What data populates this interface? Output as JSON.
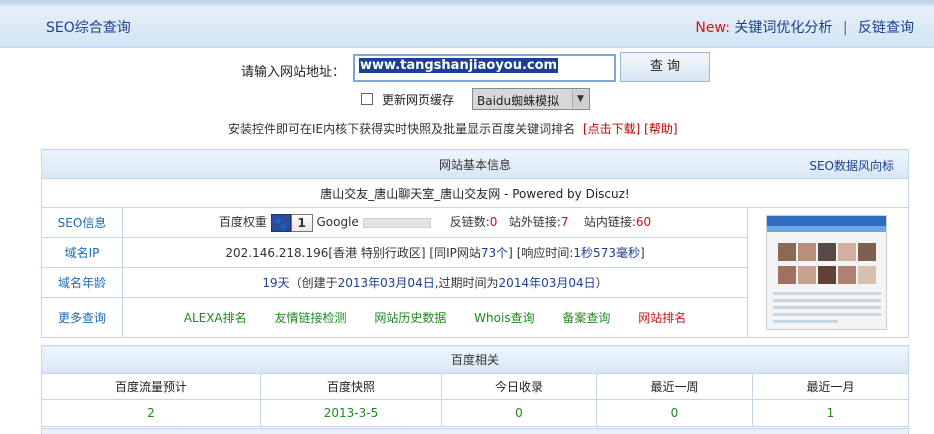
{
  "header": {
    "title": "SEO综合查询",
    "new_label": "New:",
    "link1": "关键词优化分析",
    "separator": "|",
    "link2": "反链查询"
  },
  "query": {
    "label": "请输入网站地址：",
    "url_value": "www.tangshanjiaoyou.com",
    "button": "查 询",
    "cache_label": "更新网页缓存",
    "spider_select": "Baidu蜘蛛模拟",
    "notice_text": "安装控件即可在IE内核下获得实时快照及批量显示百度关键词排名",
    "notice_download": "[点击下载]",
    "notice_help": "[帮助]"
  },
  "basic": {
    "header": "网站基本信息",
    "header_link": "SEO数据风向标",
    "site_title": "唐山交友_唐山聊天室_唐山交友网 - Powered by Discuz!",
    "seo_label": "SEO信息",
    "baidu_weight_label": "百度权重",
    "baidu_weight_value": "1",
    "google_label": "Google",
    "backlinks_label": "反链数:",
    "backlinks_value": "0",
    "external_label": "站外链接:",
    "external_value": "7",
    "internal_label": "站内链接:",
    "internal_value": "60",
    "ip_label": "域名IP",
    "ip_value": "202.146.218.196[香港 特别行政区]",
    "same_ip_prefix": "[同IP网站",
    "same_ip_value": "73个",
    "same_ip_suffix": "]",
    "response_prefix": "[响应时间:",
    "response_value": "1秒573毫秒",
    "response_suffix": "]",
    "age_label": "域名年龄",
    "age_value": "19天",
    "age_detail_prefix": "（创建于",
    "created": "2013年03月04日",
    "age_detail_mid": ",过期时间为",
    "expires": "2014年03月04日",
    "age_detail_suffix": "）",
    "more_label": "更多查询",
    "more_links": [
      "ALEXA排名",
      "友情链接检测",
      "网站历史数据",
      "Whois查询",
      "备案查询",
      "网站排名"
    ]
  },
  "baidu": {
    "header": "百度相关",
    "columns": [
      "百度流量预计",
      "百度快照",
      "今日收录",
      "最近一周",
      "最近一月"
    ],
    "values": [
      "2",
      "2013-3-5",
      "0",
      "0",
      "1"
    ]
  },
  "colors": {
    "accent": "#1b3f8f",
    "red": "#d01010",
    "green": "#1f8a1f",
    "border": "#c3d6ea"
  }
}
